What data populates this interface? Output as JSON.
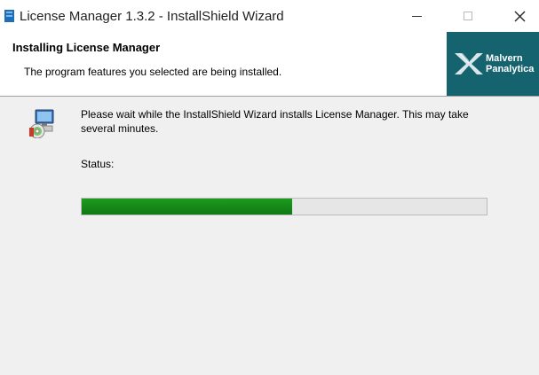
{
  "window": {
    "title": "License Manager 1.3.2 - InstallShield Wizard",
    "buttons": {
      "minimize_icon": "minimize-icon",
      "maximize_icon": "maximize-icon",
      "close_icon": "close-icon"
    }
  },
  "header": {
    "title": "Installing License Manager",
    "subtitle": "The program features you selected are being installed.",
    "brand": {
      "line1": "Malvern",
      "line2": "Panalytica",
      "background": "#15636f"
    }
  },
  "body": {
    "message": "Please wait while the InstallShield Wizard installs License Manager. This may take several minutes.",
    "status_label": "Status:",
    "status_value": "",
    "progress": {
      "percent": 52,
      "color": "#16891a"
    }
  }
}
